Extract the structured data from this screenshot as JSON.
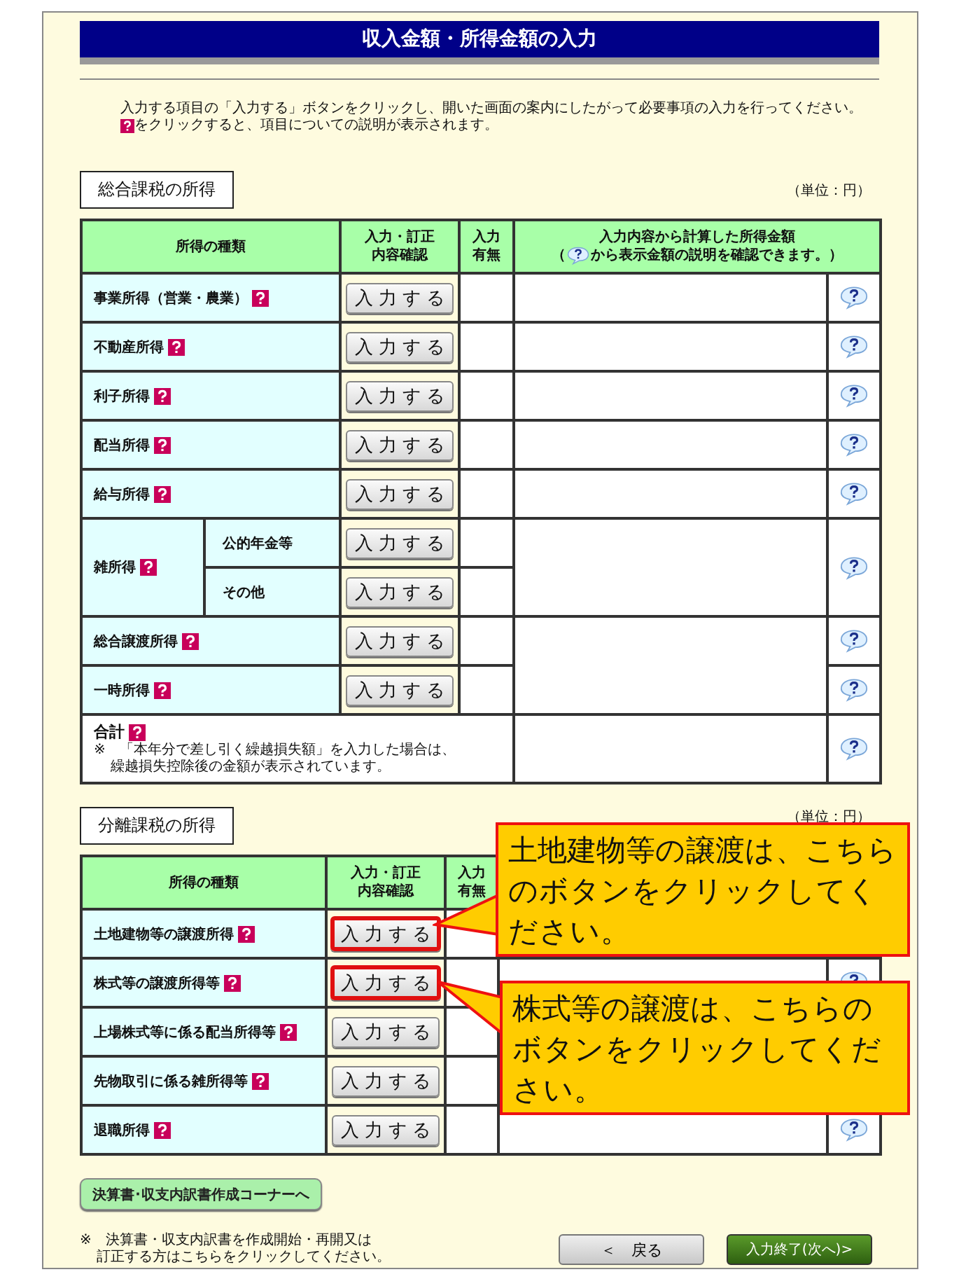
{
  "title": "収入金額・所得金額の入力",
  "intro": {
    "line1": "入力する項目の「入力する」ボタンをクリックし、開いた画面の案内にしたがって必要事項の入力を行ってください。",
    "line2": "をクリックすると、項目についての説明が表示されます。"
  },
  "general": {
    "label": "総合課税の所得",
    "unit": "（単位：円）",
    "headers": {
      "type": "所得の種類",
      "action": [
        "入力・訂正",
        "内容確認"
      ],
      "entered": [
        "入力",
        "有無"
      ],
      "amount_line1": "入力内容から計算した所得金額",
      "amount_pre": "（",
      "amount_post": "から表示金額の説明を確認できます。）"
    },
    "rows": [
      {
        "name": "事業所得（営業・農業）",
        "button": "入力する"
      },
      {
        "name": "不動産所得",
        "button": "入力する"
      },
      {
        "name": "利子所得",
        "button": "入力する"
      },
      {
        "name": "配当所得",
        "button": "入力する"
      },
      {
        "name": "給与所得",
        "button": "入力する"
      },
      {
        "name": "雑所得",
        "subrows": [
          {
            "name": "公的年金等",
            "button": "入力する"
          },
          {
            "name": "その他",
            "button": "入力する"
          }
        ]
      },
      {
        "name": "総合譲渡所得",
        "button": "入力する"
      },
      {
        "name": "一時所得",
        "button": "入力する"
      }
    ],
    "total": {
      "name": "合計",
      "note": [
        "※　「本年分で差し引く繰越損失額」を入力した場合は、",
        "繰越損失控除後の金額が表示されています。"
      ]
    }
  },
  "separate": {
    "label": "分離課税の所得",
    "unit": "（単位：円）",
    "headers": {
      "type": "所得の種類",
      "action": [
        "入力・訂正",
        "内容確認"
      ],
      "entered": [
        "入力",
        "有無"
      ]
    },
    "rows": [
      {
        "name": "土地建物等の譲渡所得",
        "button": "入力する",
        "highlighted": true
      },
      {
        "name": "株式等の譲渡所得等",
        "button": "入力する",
        "highlighted": true,
        "help_bubble": true
      },
      {
        "name": "上場株式等に係る配当所得等",
        "button": "入力する",
        "highlighted": false
      },
      {
        "name": "先物取引に係る雑所得等",
        "button": "入力する",
        "highlighted": false
      },
      {
        "name": "退職所得",
        "button": "入力する",
        "highlighted": false,
        "help_bubble": true
      }
    ]
  },
  "callouts": [
    {
      "text": "土地建物等の譲渡は、こちらのボタンをクリックしてください。"
    },
    {
      "text": "株式等の譲渡は、こちらのボタンをクリックしてください。"
    }
  ],
  "corner_button": "決算書･収支内訳書作成コーナーへ",
  "footnote": [
    "※　決算書・収支内訳書を作成開始・再開又は",
    "訂正する方はこちらをクリックしてください。"
  ],
  "back_button": "＜　戻る",
  "next_button": "入力終了(次へ)>"
}
